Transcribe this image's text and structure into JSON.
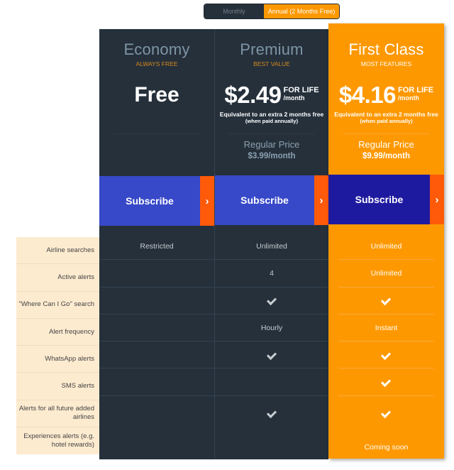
{
  "billing_toggle": {
    "options": [
      "Monthly",
      "Annual (2 Months Free)"
    ],
    "selected": "Annual (2 Months Free)"
  },
  "colors": {
    "dark_column": "#25303b",
    "highlight_column": "#fe9800",
    "subscribe_blue": "#3749c8",
    "subscribe_dark_blue": "#1e1aa0",
    "arrow_orange": "#fe5a0a",
    "label_background": "#fdebd0"
  },
  "features": [
    "Airline searches",
    "Active alerts",
    "\"Where Can I Go\" search",
    "Alert frequency",
    "WhatsApp alerts",
    "SMS alerts",
    "Alerts for all future added airlines",
    "Experiences alerts (e.g. hotel rewards)"
  ],
  "plans": {
    "economy": {
      "name": "Economy",
      "tag": "ALWAYS FREE",
      "price": "Free",
      "subscribe_label": "Subscribe",
      "subscribe_icon": "chevron-right-icon",
      "values": [
        "Restricted",
        "",
        "",
        "",
        "",
        "",
        "",
        ""
      ]
    },
    "premium": {
      "name": "Premium",
      "tag": "BEST VALUE",
      "price": "$2.49",
      "price_suffix_1": "FOR LIFE",
      "price_suffix_2": "/month",
      "equivalent_line1": "Equivalent to an extra 2 months free",
      "equivalent_line2": "(when paid annually)",
      "regular_label": "Regular Price",
      "regular_value": "$3.99/month",
      "subscribe_label": "Subscribe",
      "subscribe_icon": "chevron-right-icon",
      "values": [
        "Unlimited",
        "4",
        "check",
        "Hourly",
        "check",
        "",
        "check",
        ""
      ]
    },
    "first_class": {
      "name": "First Class",
      "tag": "MOST FEATURES",
      "price": "$4.16",
      "price_suffix_1": "FOR LIFE",
      "price_suffix_2": "/month",
      "equivalent_line1": "Equivalent to an extra 2 months free",
      "equivalent_line2": "(when paid annually)",
      "regular_label": "Regular Price",
      "regular_value": "$9.99/month",
      "subscribe_label": "Subscribe",
      "subscribe_icon": "chevron-right-icon",
      "values": [
        "Unlimited",
        "Unlimited",
        "check",
        "Instant",
        "check",
        "check",
        "check",
        "Coming soon"
      ]
    }
  }
}
